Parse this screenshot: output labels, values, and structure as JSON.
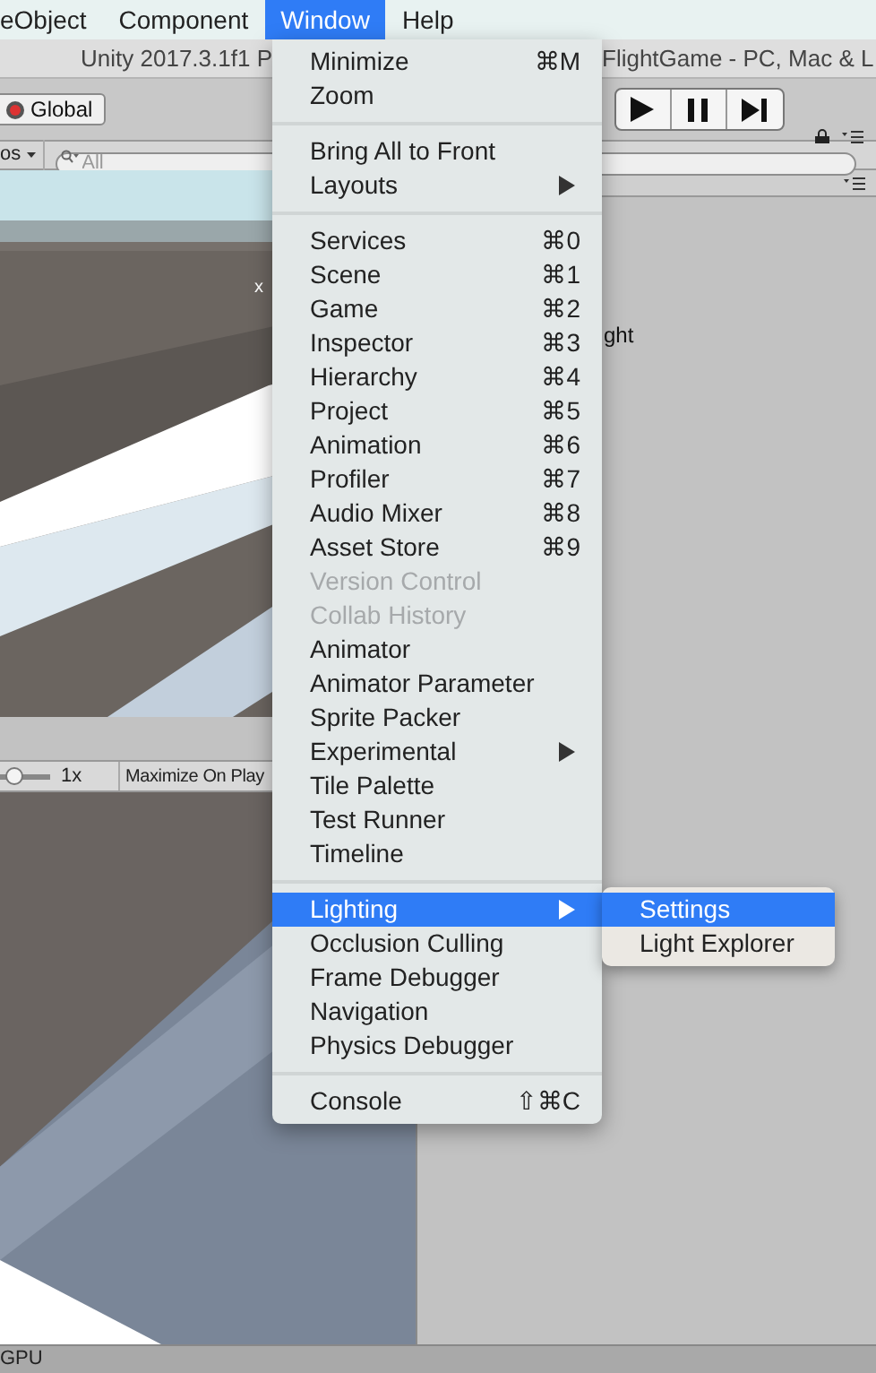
{
  "menubar": {
    "items": [
      {
        "label": "eObject",
        "selected": false
      },
      {
        "label": "Component",
        "selected": false
      },
      {
        "label": "Window",
        "selected": true
      },
      {
        "label": "Help",
        "selected": false
      }
    ]
  },
  "title_bar": {
    "left": "Unity 2017.3.1f1 P",
    "right": "FlightGame - PC, Mac & L"
  },
  "toolbar": {
    "global_button": "Global"
  },
  "hierarchy_bar": {
    "dropdown": "os",
    "search_placeholder": "All"
  },
  "scene_view": {
    "axis_label": "x"
  },
  "inspector": {
    "text": "ght"
  },
  "game_toolbar": {
    "scale_slider": {
      "level": 0.15
    },
    "scale": "1x",
    "maximize_button": "Maximize On Play"
  },
  "status_bar": {
    "text": "GPU"
  },
  "window_menu": {
    "groups": [
      [
        {
          "label": "Minimize",
          "shortcut": "⌘M",
          "submenu": false,
          "disabled": false,
          "selected": false
        },
        {
          "label": "Zoom",
          "submenu": false,
          "disabled": false,
          "selected": false
        }
      ],
      [
        {
          "label": "Bring All to Front",
          "submenu": false,
          "disabled": false,
          "selected": false
        },
        {
          "label": "Layouts",
          "submenu": true,
          "disabled": false,
          "selected": false
        }
      ],
      [
        {
          "label": "Services",
          "shortcut": "⌘0",
          "submenu": false,
          "disabled": false,
          "selected": false
        },
        {
          "label": "Scene",
          "shortcut": "⌘1",
          "submenu": false,
          "disabled": false,
          "selected": false
        },
        {
          "label": "Game",
          "shortcut": "⌘2",
          "submenu": false,
          "disabled": false,
          "selected": false
        },
        {
          "label": "Inspector",
          "shortcut": "⌘3",
          "submenu": false,
          "disabled": false,
          "selected": false
        },
        {
          "label": "Hierarchy",
          "shortcut": "⌘4",
          "submenu": false,
          "disabled": false,
          "selected": false
        },
        {
          "label": "Project",
          "shortcut": "⌘5",
          "submenu": false,
          "disabled": false,
          "selected": false
        },
        {
          "label": "Animation",
          "shortcut": "⌘6",
          "submenu": false,
          "disabled": false,
          "selected": false
        },
        {
          "label": "Profiler",
          "shortcut": "⌘7",
          "submenu": false,
          "disabled": false,
          "selected": false
        },
        {
          "label": "Audio Mixer",
          "shortcut": "⌘8",
          "submenu": false,
          "disabled": false,
          "selected": false
        },
        {
          "label": "Asset Store",
          "shortcut": "⌘9",
          "submenu": false,
          "disabled": false,
          "selected": false
        },
        {
          "label": "Version Control",
          "submenu": false,
          "disabled": true,
          "selected": false
        },
        {
          "label": "Collab History",
          "submenu": false,
          "disabled": true,
          "selected": false
        },
        {
          "label": "Animator",
          "submenu": false,
          "disabled": false,
          "selected": false
        },
        {
          "label": "Animator Parameter",
          "submenu": false,
          "disabled": false,
          "selected": false
        },
        {
          "label": "Sprite Packer",
          "submenu": false,
          "disabled": false,
          "selected": false
        },
        {
          "label": "Experimental",
          "submenu": true,
          "disabled": false,
          "selected": false
        },
        {
          "label": "Tile Palette",
          "submenu": false,
          "disabled": false,
          "selected": false
        },
        {
          "label": "Test Runner",
          "submenu": false,
          "disabled": false,
          "selected": false
        },
        {
          "label": "Timeline",
          "submenu": false,
          "disabled": false,
          "selected": false
        }
      ],
      [
        {
          "label": "Lighting",
          "submenu": true,
          "disabled": false,
          "selected": true
        },
        {
          "label": "Occlusion Culling",
          "submenu": false,
          "disabled": false,
          "selected": false
        },
        {
          "label": "Frame Debugger",
          "submenu": false,
          "disabled": false,
          "selected": false
        },
        {
          "label": "Navigation",
          "submenu": false,
          "disabled": false,
          "selected": false
        },
        {
          "label": "Physics Debugger",
          "submenu": false,
          "disabled": false,
          "selected": false
        }
      ],
      [
        {
          "label": "Console",
          "shortcut": "⇧⌘C",
          "submenu": false,
          "disabled": false,
          "selected": false
        }
      ]
    ]
  },
  "lighting_submenu": {
    "items": [
      {
        "label": "Settings",
        "selected": true
      },
      {
        "label": "Light Explorer",
        "selected": false
      }
    ]
  }
}
